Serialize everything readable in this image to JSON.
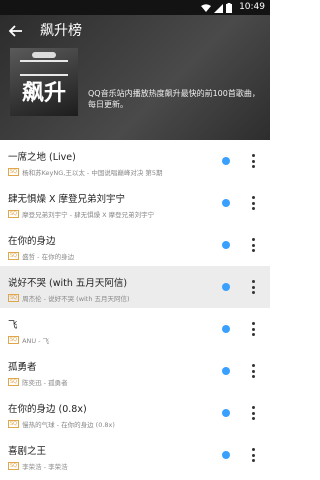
{
  "status_bar": {
    "time": "10:49"
  },
  "header": {
    "title": "飙升榜"
  },
  "cover": {
    "big_text": "飙升"
  },
  "description": "QQ音乐站内播放热度飙升最快的前100首歌曲，每日更新。",
  "songs": [
    {
      "title": "一席之地 (Live)",
      "quality": "SQ",
      "subtitle": "杨和苏KeyNG,王以太 - 中国说唱巅峰对决 第5期"
    },
    {
      "title": "肆无惧燥 X 摩登兄弟刘宇宁",
      "quality": "SQ",
      "subtitle": "摩登兄弟刘宇宁 - 肆无惧燥 X 摩登兄弟刘宇宁"
    },
    {
      "title": "在你的身边",
      "quality": "SQ",
      "subtitle": "盛哲 - 在你的身边"
    },
    {
      "title": "说好不哭 (with 五月天阿信)",
      "quality": "SQ",
      "subtitle": "周杰伦 - 说好不哭 (with 五月天阿信)"
    },
    {
      "title": "飞",
      "quality": "SQ",
      "subtitle": "ANU - 飞"
    },
    {
      "title": "孤勇者",
      "quality": "SQ",
      "subtitle": "陈奕迅 - 孤勇者"
    },
    {
      "title": "在你的身边 (0.8x)",
      "quality": "SQ",
      "subtitle": "慢热的气球 - 在你的身边 (0.8x)"
    },
    {
      "title": "喜剧之王",
      "quality": "SQ",
      "subtitle": "李荣浩 - 李荣浩"
    }
  ],
  "colors": {
    "header_bg": "#3a3a3a",
    "accent_play": "#3aa0ff",
    "quality_badge": "#e2a64a",
    "selected_row": "#ececec"
  },
  "icons": [
    "back-arrow-icon",
    "wifi-icon",
    "signal-icon",
    "battery-icon",
    "play-icon",
    "more-vert-icon"
  ]
}
